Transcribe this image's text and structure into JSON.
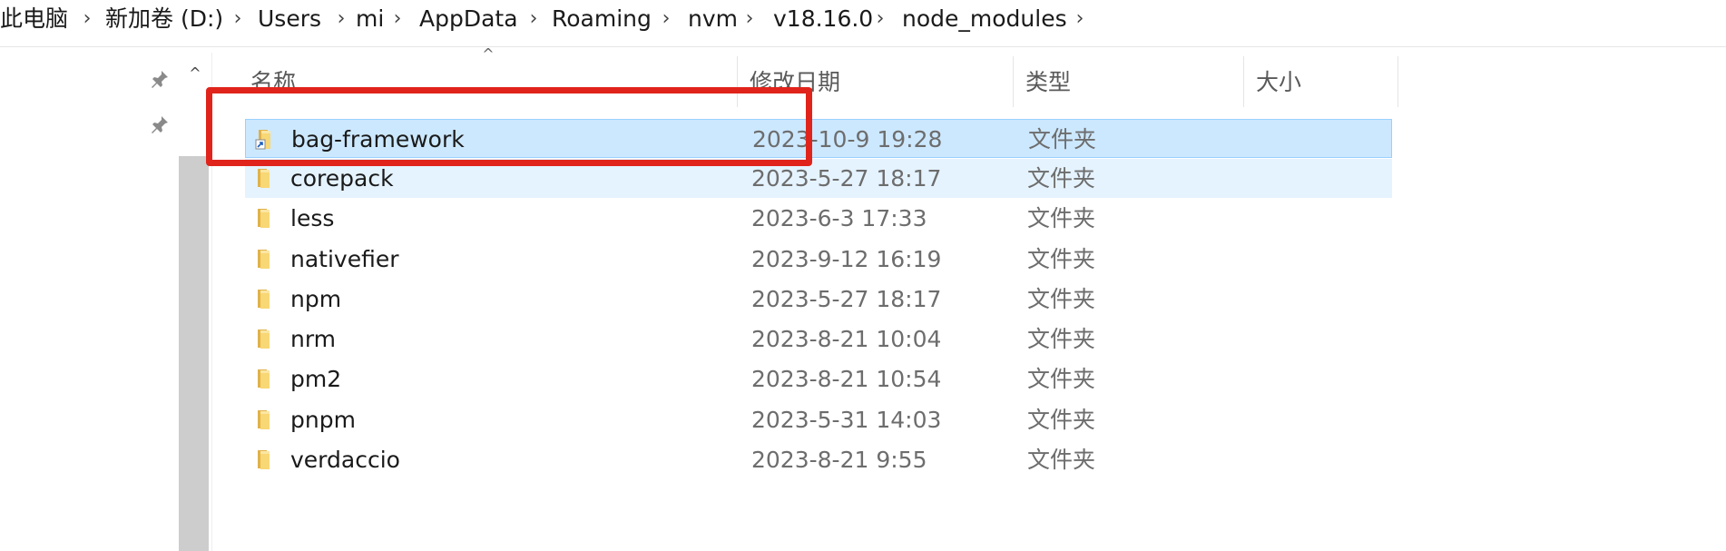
{
  "breadcrumb": {
    "items": [
      "此电脑",
      "新加卷 (D:)",
      "Users",
      "mi",
      "AppData",
      "Roaming",
      "nvm",
      "v18.16.0",
      "node_modules"
    ],
    "separator": "›"
  },
  "nav": {
    "pin_icon": "pin-icon",
    "collapse_glyph": "^"
  },
  "columns": {
    "name": "名称",
    "date": "修改日期",
    "type": "类型",
    "size": "大小"
  },
  "sort_glyph": "^",
  "rows": [
    {
      "name": "bag-framework",
      "date": "2023-10-9 19:28",
      "type": "文件夹",
      "state": "selected",
      "shortcut": true
    },
    {
      "name": "corepack",
      "date": "2023-5-27 18:17",
      "type": "文件夹",
      "state": "hover",
      "shortcut": false
    },
    {
      "name": "less",
      "date": "2023-6-3 17:33",
      "type": "文件夹",
      "state": "normal",
      "shortcut": false
    },
    {
      "name": "nativefier",
      "date": "2023-9-12 16:19",
      "type": "文件夹",
      "state": "normal",
      "shortcut": false
    },
    {
      "name": "npm",
      "date": "2023-5-27 18:17",
      "type": "文件夹",
      "state": "normal",
      "shortcut": false
    },
    {
      "name": "nrm",
      "date": "2023-8-21 10:04",
      "type": "文件夹",
      "state": "normal",
      "shortcut": false
    },
    {
      "name": "pm2",
      "date": "2023-8-21 10:54",
      "type": "文件夹",
      "state": "normal",
      "shortcut": false
    },
    {
      "name": "pnpm",
      "date": "2023-5-31 14:03",
      "type": "文件夹",
      "state": "normal",
      "shortcut": false
    },
    {
      "name": "verdaccio",
      "date": "2023-8-21 9:55",
      "type": "文件夹",
      "state": "normal",
      "shortcut": false
    }
  ],
  "colors": {
    "selection_bg": "#cce8ff",
    "selection_border": "#99d1ff",
    "hover_bg": "#e5f3ff",
    "annotation_red": "#e0241b",
    "folder_yellow": "#f8d775"
  }
}
